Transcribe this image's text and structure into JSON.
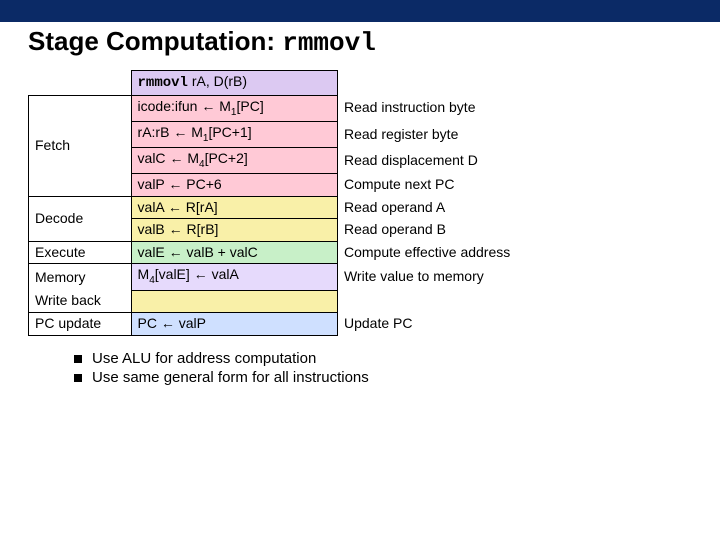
{
  "title": {
    "plain": "Stage Computation: ",
    "mono": "rmmovl"
  },
  "header": {
    "mono": "rmmovl",
    "rest": " rA, D(rB)"
  },
  "arrow": "←",
  "stages": {
    "fetch": "Fetch",
    "decode": "Decode",
    "execute": "Execute",
    "memory": "Memory",
    "write": "Write back",
    "pc": "PC update"
  },
  "ops": {
    "fetch1": {
      "lhs": "icode:ifun",
      "rhs": "M",
      "sub": "1",
      "tail": "[PC]"
    },
    "fetch2": {
      "lhs": "rA:rB",
      "rhs": "M",
      "sub": "1",
      "tail": "[PC+1]"
    },
    "fetch3": {
      "lhs": "valC",
      "rhs": "M",
      "sub": "4",
      "tail": "[PC+2]"
    },
    "fetch4": {
      "lhs": "valP",
      "rhs": "PC+6"
    },
    "dec1": {
      "lhs": "valA",
      "rhs": "R[rA]"
    },
    "dec2": {
      "lhs": "valB",
      "rhs": "R[rB]"
    },
    "exe": {
      "lhs": "valE",
      "rhs": "valB + valC"
    },
    "mem": {
      "pre": "M",
      "sub": "4",
      "mid": "[valE]",
      "rhs": "valA"
    },
    "pc": {
      "lhs": "PC",
      "rhs": "valP"
    }
  },
  "desc": {
    "fetch1": "Read instruction byte",
    "fetch2": "Read register byte",
    "fetch3": "Read displacement D",
    "fetch4": "Compute next PC",
    "dec1": "Read operand A",
    "dec2": "Read operand B",
    "exe": "Compute effective address",
    "mem": "Write value to memory",
    "pc": "Update PC"
  },
  "notes": [
    "Use ALU for address computation",
    "Use same general form for all instructions"
  ]
}
